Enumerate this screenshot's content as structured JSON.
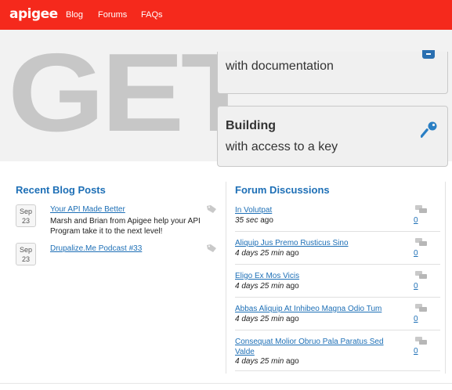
{
  "header": {
    "logo": "apigee",
    "nav": [
      "Blog",
      "Forums",
      "FAQs"
    ],
    "brand_color": "#f5291c"
  },
  "hero": {
    "big_word": "GET",
    "cards": [
      {
        "title": "",
        "subtitle": "with documentation",
        "icon": "document-icon"
      },
      {
        "title": "Building",
        "subtitle": "with access to a key",
        "icon": "key-icon"
      }
    ]
  },
  "blog": {
    "heading": "Recent Blog Posts",
    "posts": [
      {
        "month": "Sep",
        "day": "23",
        "title": "Your API Made Better",
        "body": "Marsh and Brian from Apigee help your API Program take it to the next level!"
      },
      {
        "month": "Sep",
        "day": "23",
        "title": "Drupalize.Me Podcast #33",
        "body": ""
      }
    ]
  },
  "forum": {
    "heading": "Forum Discussions",
    "threads": [
      {
        "title": "In Volutpat",
        "time": "35 sec",
        "suffix": "ago",
        "count": "0"
      },
      {
        "title": "Aliquip Jus Premo Rusticus Sino",
        "time": "4 days 25 min",
        "suffix": "ago",
        "count": "0"
      },
      {
        "title": "Eligo Ex Mos Vicis",
        "time": "4 days 25 min",
        "suffix": "ago",
        "count": "0"
      },
      {
        "title": "Abbas Aliquip At Inhibeo Magna Odio Tum",
        "time": "4 days 25 min",
        "suffix": "ago",
        "count": "0"
      },
      {
        "title": "Consequat Molior Obruo Pala Paratus Sed Valde",
        "time": "4 days 25 min",
        "suffix": "ago",
        "count": "0"
      }
    ]
  }
}
